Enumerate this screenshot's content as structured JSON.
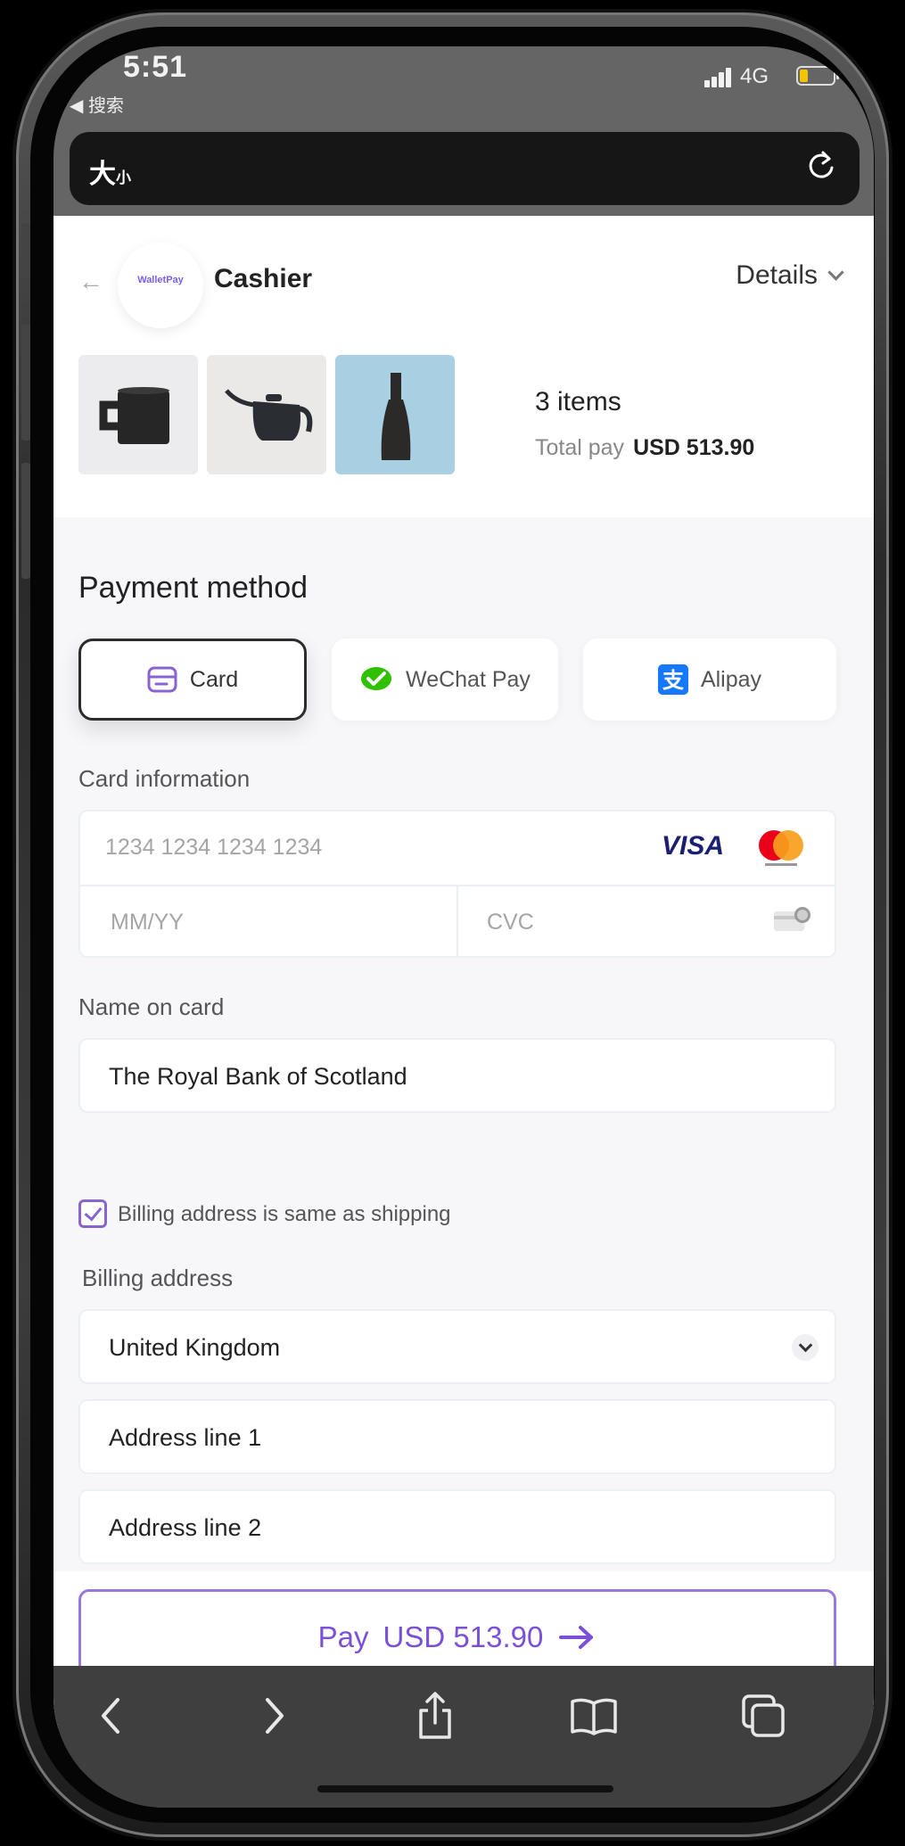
{
  "status_bar": {
    "time": "5:51",
    "back_app_label": "◀ 搜索",
    "network": "4G"
  },
  "browser": {
    "address_label_large": "大",
    "address_label_small": "小",
    "reload_icon": "reload-icon"
  },
  "merchant": {
    "logo_text": "WalletPay",
    "title": "Cashier",
    "details_label": "Details"
  },
  "order": {
    "items_count": "3 items",
    "total_label": "Total pay",
    "total_amount": "USD 513.90",
    "products": [
      "mug",
      "kettle",
      "vase"
    ]
  },
  "payment": {
    "section_title": "Payment method",
    "methods": [
      {
        "label": "Card",
        "icon": "card-icon",
        "selected": true
      },
      {
        "label": "WeChat Pay",
        "icon": "wechat-icon",
        "selected": false
      },
      {
        "label": "Alipay",
        "icon": "alipay-icon",
        "selected": false
      }
    ]
  },
  "card": {
    "section_label": "Card information",
    "number_placeholder": "1234 1234 1234 1234",
    "brand_visa": "VISA",
    "expiry_placeholder": "MM/YY",
    "cvc_placeholder": "CVC",
    "name_label": "Name on card",
    "name_value": "The Royal Bank of Scotland"
  },
  "billing": {
    "same_as_shipping_label": "Billing address is same as shipping",
    "same_as_shipping_checked": true,
    "section_label": "Billing address",
    "country": "United Kingdom",
    "line1_placeholder": "Address line 1",
    "line2_placeholder": "Address line 2"
  },
  "pay_button": {
    "label": "Pay",
    "amount": "USD 513.90"
  },
  "colors": {
    "accent": "#7b4fd6",
    "accent_border": "#9a77dd",
    "battery": "#f5c400",
    "wechat": "#2dc100",
    "alipay": "#1677ff"
  }
}
